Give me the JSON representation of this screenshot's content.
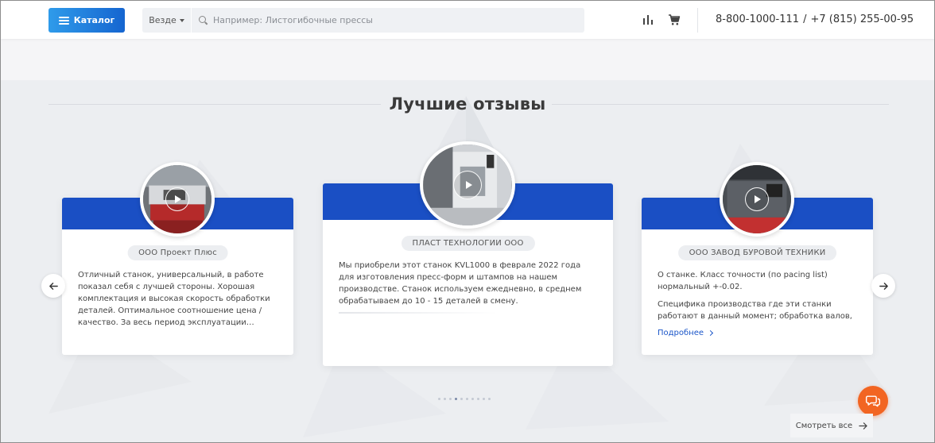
{
  "header": {
    "catalog_label": "Каталог",
    "search_scope": "Везде",
    "search_placeholder": "Например: Листогибочные прессы",
    "search_value": "",
    "phone_primary": "8-800-1000-111",
    "phone_separator": "/",
    "phone_secondary": "+7 (815) 255-00-95"
  },
  "reviews": {
    "title": "Лучшие отзывы",
    "cards": [
      {
        "company": "ООО Проект Плюс",
        "text": "Отличный станок, универсальный, в работе показал себя с лучшей стороны. Хорошая комплектация и высокая скорость обработки деталей. Оптимальное соотношение цена / качество. За весь период эксплуатации…"
      },
      {
        "company": "ПЛАСТ ТЕХНОЛОГИИ ООО",
        "text": "Мы приобрели этот станок KVL1000 в феврале 2022 года для изготовления пресс-форм и штампов на нашем производстве. Станок используем ежедневно, в среднем обрабатываем до 10 - 15 деталей в смену."
      },
      {
        "company": "ООО ЗАВОД БУРОВОЙ ТЕХНИКИ",
        "text_p1": "О станке. Класс точности (по pacing list) нормальный +-0.02.",
        "text_p2": "Специфика производства где эти станки работают в данный момент; обработка валов,",
        "more_label": "Подробнее"
      }
    ],
    "dots_total": 10,
    "dots_active": 3
  },
  "floating": {
    "see_all_label": "Смотреть все"
  },
  "colors": {
    "accent_blue": "#1a4fc4",
    "catalog_gradient_start": "#2f9bea",
    "catalog_gradient_end": "#1565d0",
    "chat_orange": "#f26522"
  },
  "icons": [
    "menu-icon",
    "caret-down-icon",
    "search-icon",
    "compare-chart-icon",
    "cart-icon",
    "play-icon",
    "arrow-left-icon",
    "arrow-right-icon",
    "chevron-right-icon",
    "chat-icon"
  ]
}
